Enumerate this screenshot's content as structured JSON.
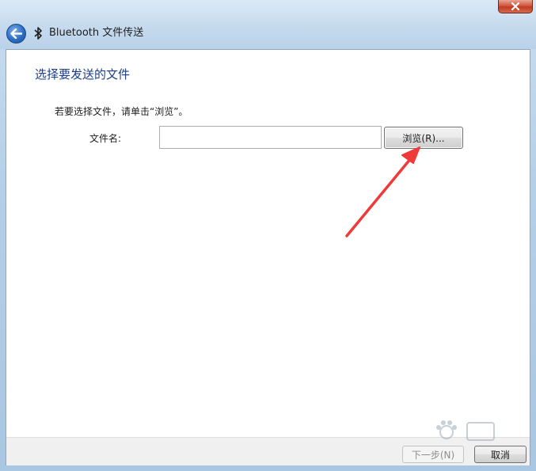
{
  "window": {
    "title": "Bluetooth 文件传送",
    "close_glyph": "✕"
  },
  "content": {
    "heading": "选择要发送的文件",
    "instruction": "若要选择文件，请单击“浏览”。",
    "file_label": "文件名:",
    "file_value": "",
    "browse_label": "浏览(R)..."
  },
  "footer": {
    "next_label": "下一步(N)",
    "cancel_label": "取消"
  },
  "colors": {
    "heading": "#1c3e8a",
    "annotation_arrow": "#f03a3a"
  },
  "icons": {
    "back": "back-arrow-icon",
    "bluetooth": "bluetooth-icon",
    "close": "close-icon"
  }
}
